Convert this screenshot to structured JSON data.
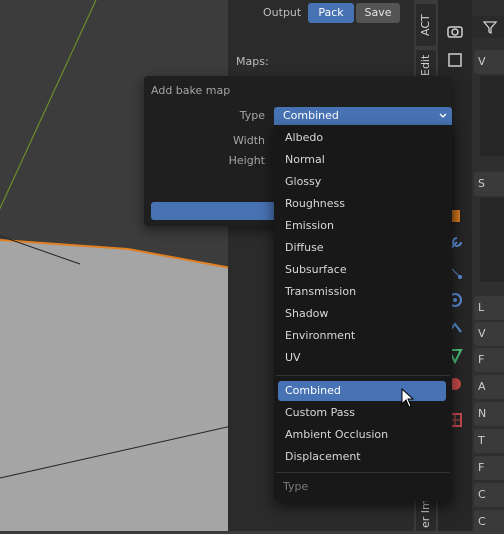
{
  "output_row": {
    "label": "Output",
    "pack_label": "Pack",
    "save_label": "Save"
  },
  "maps_label": "Maps:",
  "side_tabs": [
    "ACT",
    "Edit",
    "er Im"
  ],
  "dialog": {
    "title": "Add bake map",
    "type_label": "Type",
    "width_label": "Width",
    "height_label": "Height",
    "selected_value": "Combined"
  },
  "dropdown": {
    "group1": [
      "Albedo",
      "Normal",
      "Glossy",
      "Roughness",
      "Emission",
      "Diffuse",
      "Subsurface",
      "Transmission",
      "Shadow",
      "Environment",
      "UV"
    ],
    "group2": [
      "Combined",
      "Custom Pass",
      "Ambient Occlusion",
      "Displacement"
    ],
    "selected": "Combined",
    "footer": "Type"
  },
  "props_rows": [
    "V",
    "S",
    "L",
    "V",
    "F",
    "A",
    "N",
    "T",
    "F",
    "C",
    "C"
  ],
  "colors": {
    "accent": "#4772b3",
    "object_outline": "#e07f22",
    "plane_fill": "#a5a5a5",
    "axis_green": "#6a8c2a"
  }
}
